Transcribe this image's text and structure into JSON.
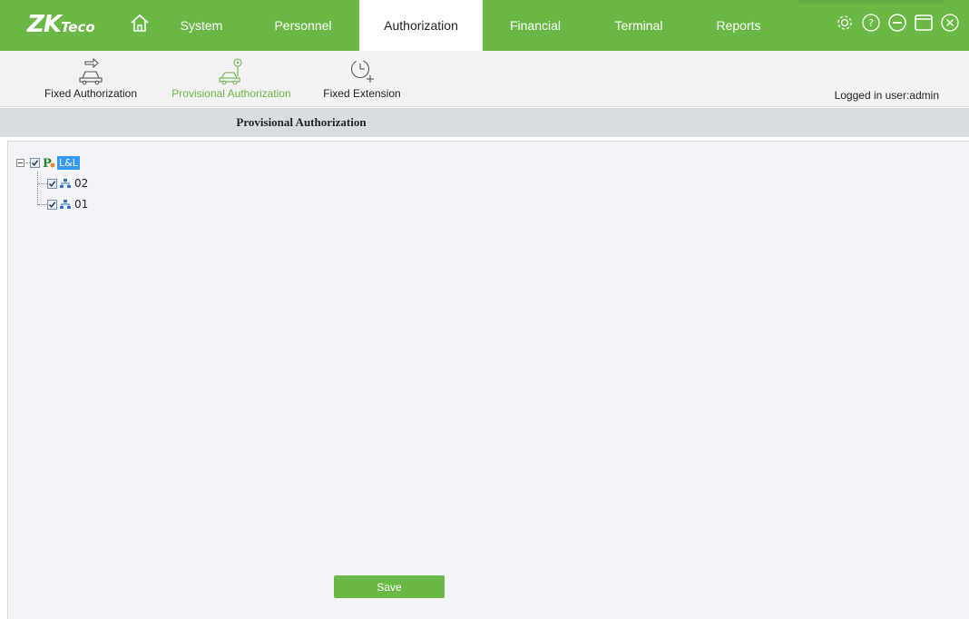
{
  "app": {
    "logo_main": "ZK",
    "logo_sub": "Teco"
  },
  "colors": {
    "brand_green": "#6ab845",
    "selected_blue": "#3399ff",
    "panel_bg": "#f2f4f8"
  },
  "menu": {
    "items": [
      {
        "label": "System",
        "active": false
      },
      {
        "label": "Personnel",
        "active": false
      },
      {
        "label": "Authorization",
        "active": true
      },
      {
        "label": "Financial",
        "active": false
      },
      {
        "label": "Terminal",
        "active": false
      },
      {
        "label": "Reports",
        "active": false
      }
    ]
  },
  "window_icons": [
    "gear-icon",
    "help-icon",
    "minimize-icon",
    "maximize-icon",
    "close-icon"
  ],
  "toolbar": {
    "items": [
      {
        "label": "Fixed Authorization",
        "icon": "car-arrow-icon",
        "active": false
      },
      {
        "label": "Provisional Authorization",
        "icon": "car-location-icon",
        "active": true
      },
      {
        "label": "Fixed Extension",
        "icon": "clock-plus-icon",
        "active": false
      }
    ],
    "logged_in": "Logged in user:admin"
  },
  "page": {
    "title": "Provisional Authorization"
  },
  "tree": {
    "root": {
      "label": "L&L",
      "checked": true,
      "expanded": true
    },
    "children": [
      {
        "label": "02",
        "checked": true
      },
      {
        "label": "01",
        "checked": true
      }
    ]
  },
  "actions": {
    "save_label": "Save"
  }
}
